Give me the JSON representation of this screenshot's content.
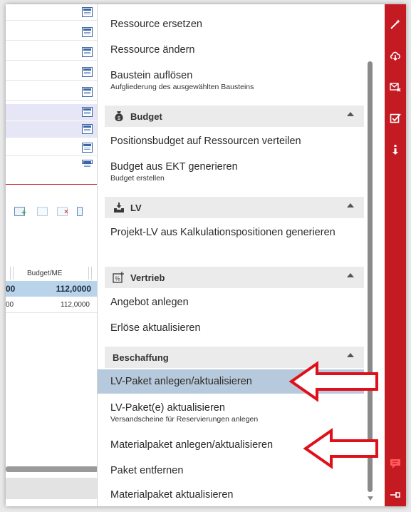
{
  "background_table": {
    "column_header": "Budget/ME",
    "row_selected": {
      "left": "00",
      "right": "112,0000"
    },
    "row_normal": {
      "left": "00",
      "right": "112,0000"
    }
  },
  "menu": {
    "items_top": [
      {
        "label": "Ressource ersetzen"
      },
      {
        "label": "Ressource ändern"
      },
      {
        "label": "Baustein auflösen",
        "sub": "Aufgliederung des ausgewählten Bausteins"
      }
    ],
    "budget": {
      "header": "Budget",
      "items": [
        {
          "label": "Positionsbudget auf Ressourcen verteilen"
        },
        {
          "label": "Budget aus EKT generieren",
          "sub": "Budget erstellen"
        }
      ]
    },
    "lv": {
      "header": "LV",
      "items": [
        {
          "label": "Projekt-LV aus Kalkulationspositionen generieren"
        }
      ]
    },
    "vertrieb": {
      "header": "Vertrieb",
      "items": [
        {
          "label": "Angebot anlegen"
        },
        {
          "label": "Erlöse aktualisieren"
        }
      ]
    },
    "beschaffung": {
      "header": "Beschaffung",
      "items": [
        {
          "label": "LV-Paket anlegen/aktualisieren"
        },
        {
          "label": "LV-Paket(e) aktualisieren",
          "sub": "Versandscheine für Reservierungen anlegen"
        },
        {
          "label": "Materialpaket anlegen/aktualisieren"
        },
        {
          "label": "Paket entfernen"
        },
        {
          "label": "Materialpaket aktualisieren"
        }
      ]
    }
  },
  "colors": {
    "accent_red": "#c41a22",
    "highlight": "#b7c9dc",
    "section_bg": "#ebebeb"
  }
}
